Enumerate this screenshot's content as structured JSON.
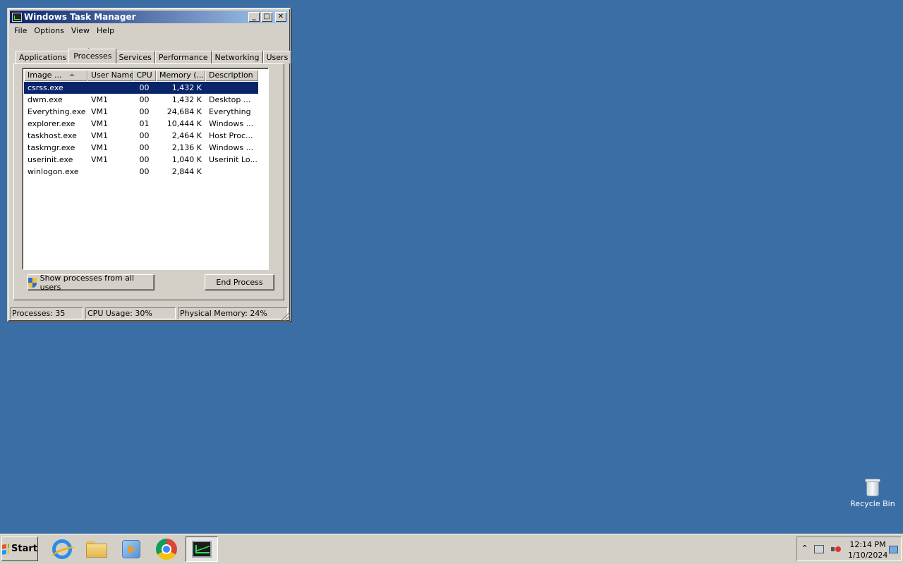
{
  "window": {
    "title": "Windows Task Manager",
    "controls": {
      "minimize": "_",
      "maximize": "□",
      "close": "✕"
    }
  },
  "menu": [
    "File",
    "Options",
    "View",
    "Help"
  ],
  "tabs": [
    "Applications",
    "Processes",
    "Services",
    "Performance",
    "Networking",
    "Users"
  ],
  "active_tab": "Processes",
  "columns": [
    "Image ...",
    "User Name",
    "CPU",
    "Memory (...",
    "Description"
  ],
  "processes": [
    {
      "image": "csrss.exe",
      "user": "",
      "cpu": "00",
      "memory": "1,432 K",
      "description": "",
      "selected": true
    },
    {
      "image": "dwm.exe",
      "user": "VM1",
      "cpu": "00",
      "memory": "1,432 K",
      "description": "Desktop ..."
    },
    {
      "image": "Everything.exe",
      "user": "VM1",
      "cpu": "00",
      "memory": "24,684 K",
      "description": "Everything"
    },
    {
      "image": "explorer.exe",
      "user": "VM1",
      "cpu": "01",
      "memory": "10,444 K",
      "description": "Windows ..."
    },
    {
      "image": "taskhost.exe",
      "user": "VM1",
      "cpu": "00",
      "memory": "2,464 K",
      "description": "Host Proc..."
    },
    {
      "image": "taskmgr.exe",
      "user": "VM1",
      "cpu": "00",
      "memory": "2,136 K",
      "description": "Windows ..."
    },
    {
      "image": "userinit.exe",
      "user": "VM1",
      "cpu": "00",
      "memory": "1,040 K",
      "description": "Userinit Lo..."
    },
    {
      "image": "winlogon.exe",
      "user": "",
      "cpu": "00",
      "memory": "2,844 K",
      "description": ""
    }
  ],
  "buttons": {
    "show_all": "Show processes from all users",
    "end_process": "End Process"
  },
  "status": {
    "processes": "Processes: 35",
    "cpu": "CPU Usage: 30%",
    "memory": "Physical Memory: 24%"
  },
  "desktop": {
    "recycle_bin": "Recycle Bin"
  },
  "taskbar": {
    "start": "Start",
    "pinned": [
      "internet-explorer-icon",
      "folder-icon",
      "media-player-icon",
      "chrome-icon",
      "task-manager-icon"
    ],
    "clock_time": "12:14 PM",
    "clock_date": "1/10/2024"
  },
  "colors": {
    "desktop": "#3a6ea5",
    "titlebar_start": "#0a246a",
    "titlebar_end": "#a6caf0",
    "selection": "#0a246a"
  }
}
